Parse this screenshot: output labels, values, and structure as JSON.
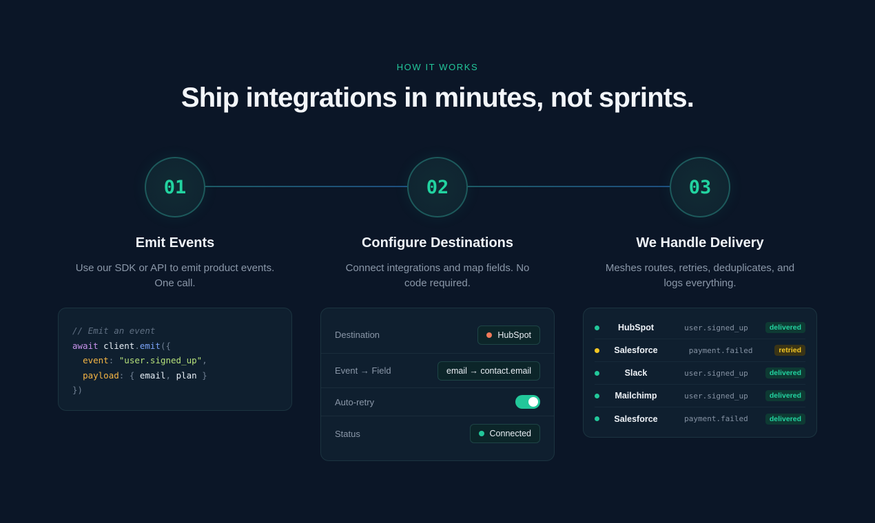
{
  "section": {
    "eyebrow": "HOW IT WORKS",
    "headline": "Ship integrations in minutes, not sprints."
  },
  "colors": {
    "accent": "#22c79a",
    "background": "#0b1627",
    "card": "#0f1f2f",
    "retried": "#f3c623",
    "hubspot_dot": "#f07a5a"
  },
  "steps": [
    {
      "number": "01",
      "title": "Emit Events",
      "description": "Use our SDK or API to emit product events. One call."
    },
    {
      "number": "02",
      "title": "Configure Destinations",
      "description": "Connect integrations and map fields. No code required."
    },
    {
      "number": "03",
      "title": "We Handle Delivery",
      "description": "Meshes routes, retries, deduplicates, and logs everything."
    }
  ],
  "code": {
    "comment": "// Emit an event",
    "kw_await": "await",
    "obj": "client",
    "fn": "emit",
    "open": "({",
    "key_event": "event",
    "val_event": "\"user.signed_up\"",
    "key_payload": "payload",
    "payload_open": "{",
    "payload_a": "email",
    "payload_b": "plan",
    "payload_close": "}",
    "close": "})"
  },
  "config": {
    "destination": {
      "label": "Destination",
      "value": "HubSpot"
    },
    "mapping": {
      "label": "Event → Field",
      "value": "email → contact.email"
    },
    "autoretry": {
      "label": "Auto-retry",
      "enabled": true
    },
    "status": {
      "label": "Status",
      "value": "Connected"
    }
  },
  "deliveries": [
    {
      "destination": "HubSpot",
      "event": "user.signed_up",
      "status": "delivered"
    },
    {
      "destination": "Salesforce",
      "event": "payment.failed",
      "status": "retried"
    },
    {
      "destination": "Slack",
      "event": "user.signed_up",
      "status": "delivered"
    },
    {
      "destination": "Mailchimp",
      "event": "user.signed_up",
      "status": "delivered"
    },
    {
      "destination": "Salesforce",
      "event": "payment.failed",
      "status": "delivered"
    }
  ]
}
